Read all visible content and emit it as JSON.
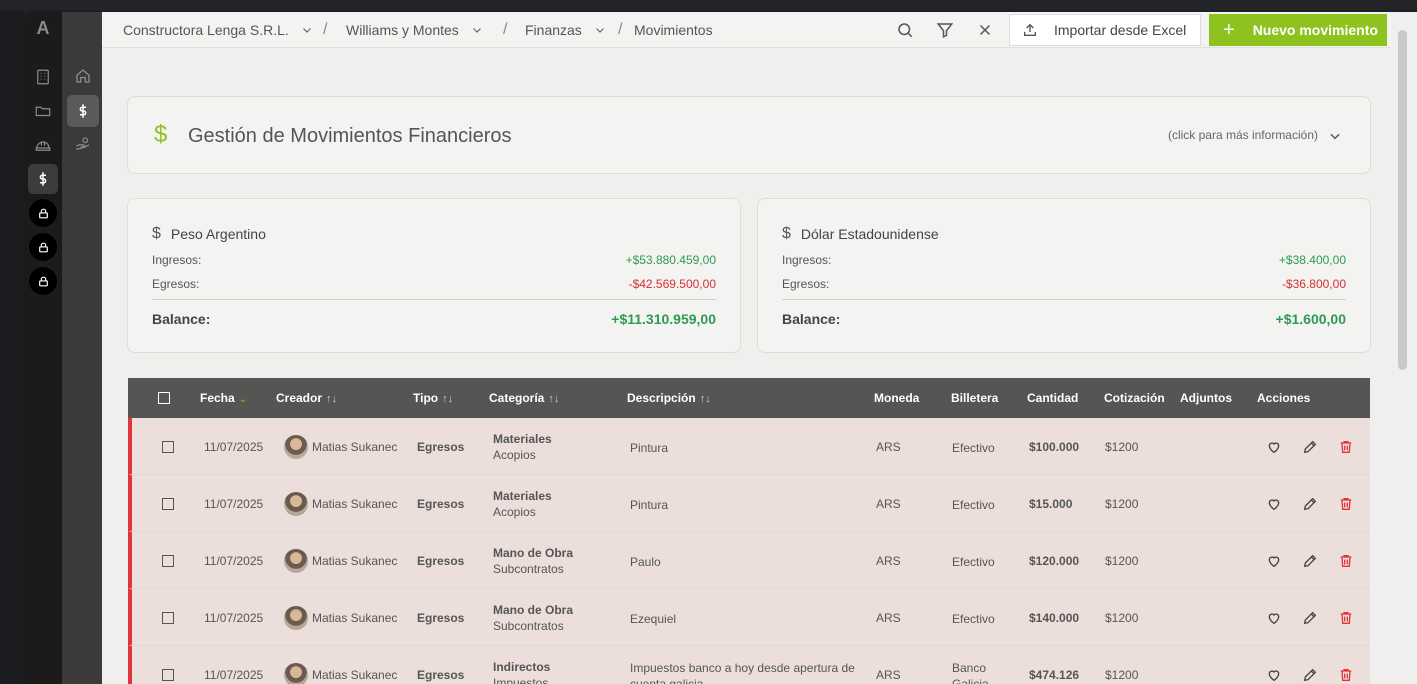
{
  "sidebar": {
    "logo": "A"
  },
  "breadcrumb": {
    "company": "Constructora Lenga S.R.L.",
    "project": "Williams y Montes",
    "section": "Finanzas",
    "page": "Movimientos",
    "separator": "/"
  },
  "toolbar": {
    "import_label": "Importar desde Excel",
    "new_label": "Nuevo movimiento",
    "new_plus": "+"
  },
  "title_card": {
    "icon": "$",
    "title": "Gestión de Movimientos Financieros",
    "info": "(click para más información)"
  },
  "currencies": [
    {
      "icon": "$",
      "name": "Peso Argentino",
      "income_label": "Ingresos:",
      "income": "+$53.880.459,00",
      "expense_label": "Egresos:",
      "expense": "-$42.569.500,00",
      "balance_label": "Balance:",
      "balance": "+$11.310.959,00"
    },
    {
      "icon": "$",
      "name": "Dólar Estadounidense",
      "income_label": "Ingresos:",
      "income": "+$38.400,00",
      "expense_label": "Egresos:",
      "expense": "-$36.800,00",
      "balance_label": "Balance:",
      "balance": "+$1.600,00"
    }
  ],
  "table": {
    "headers": {
      "fecha": "Fecha",
      "creador": "Creador",
      "tipo": "Tipo",
      "categoria": "Categoría",
      "descripcion": "Descripción",
      "moneda": "Moneda",
      "billetera": "Billetera",
      "cantidad": "Cantidad",
      "cotizacion": "Cotización",
      "adjuntos": "Adjuntos",
      "acciones": "Acciones",
      "sort_glyph": "↑↓",
      "sort_active_glyph": "⌄"
    },
    "rows": [
      {
        "fecha": "11/07/2025",
        "creador": "Matias Sukanec",
        "tipo": "Egresos",
        "categoria": "Materiales",
        "subcategoria": "Acopios",
        "descripcion": "Pintura",
        "moneda": "ARS",
        "billetera": "Efectivo",
        "cantidad": "$100.000",
        "cotizacion": "$1200"
      },
      {
        "fecha": "11/07/2025",
        "creador": "Matias Sukanec",
        "tipo": "Egresos",
        "categoria": "Materiales",
        "subcategoria": "Acopios",
        "descripcion": "Pintura",
        "moneda": "ARS",
        "billetera": "Efectivo",
        "cantidad": "$15.000",
        "cotizacion": "$1200"
      },
      {
        "fecha": "11/07/2025",
        "creador": "Matias Sukanec",
        "tipo": "Egresos",
        "categoria": "Mano de Obra",
        "subcategoria": "Subcontratos",
        "descripcion": "Paulo",
        "moneda": "ARS",
        "billetera": "Efectivo",
        "cantidad": "$120.000",
        "cotizacion": "$1200"
      },
      {
        "fecha": "11/07/2025",
        "creador": "Matias Sukanec",
        "tipo": "Egresos",
        "categoria": "Mano de Obra",
        "subcategoria": "Subcontratos",
        "descripcion": "Ezequiel",
        "moneda": "ARS",
        "billetera": "Efectivo",
        "cantidad": "$140.000",
        "cotizacion": "$1200"
      },
      {
        "fecha": "11/07/2025",
        "creador": "Matias Sukanec",
        "tipo": "Egresos",
        "categoria": "Indirectos",
        "subcategoria": "Impuestos",
        "descripcion": "Impuestos banco a hoy desde apertura de cuenta galicia",
        "moneda": "ARS",
        "billetera": "Banco Galicia",
        "cantidad": "$474.126",
        "cotizacion": "$1200"
      }
    ]
  },
  "colors": {
    "accent": "#8dc21f",
    "income": "#2e9a52",
    "expense": "#d63030",
    "row_bg": "#ecdfdb",
    "row_marker": "#e0343a"
  }
}
